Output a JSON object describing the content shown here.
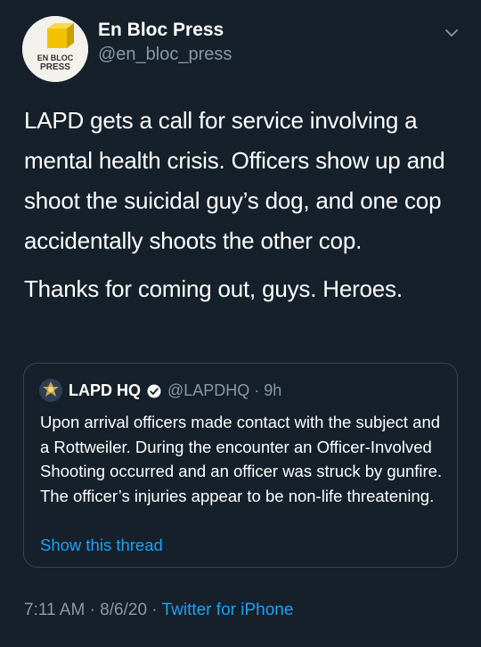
{
  "author": {
    "name": "En Bloc Press",
    "handle": "@en_bloc_press",
    "avatar_text": "EN BLOC PRESS"
  },
  "tweet": {
    "paragraphs": [
      "LAPD gets a call for service involving a mental health crisis. Officers show up and shoot the suicidal guy’s dog, and one cop accidentally shoots the other cop.",
      "Thanks for coming out, guys. Heroes."
    ]
  },
  "quoted": {
    "name": "LAPD HQ",
    "handle_time": "@LAPDHQ · 9h",
    "text": "Upon arrival officers made contact with the subject and a Rottweiler. During the encounter an Officer-Involved Shooting occurred and an officer was struck by gunfire. The officer’s injuries appear to be non-life threatening.",
    "show_thread": "Show this thread"
  },
  "meta": {
    "timestamp": "7:11 AM · 8/6/20 · ",
    "source": "Twitter for iPhone"
  },
  "icons": {
    "more": "chevron-down-icon",
    "verified": "verified-badge-icon"
  },
  "colors": {
    "background": "#15202b",
    "secondary_text": "#8899a6",
    "link": "#1da1f2",
    "border": "#38444d"
  }
}
